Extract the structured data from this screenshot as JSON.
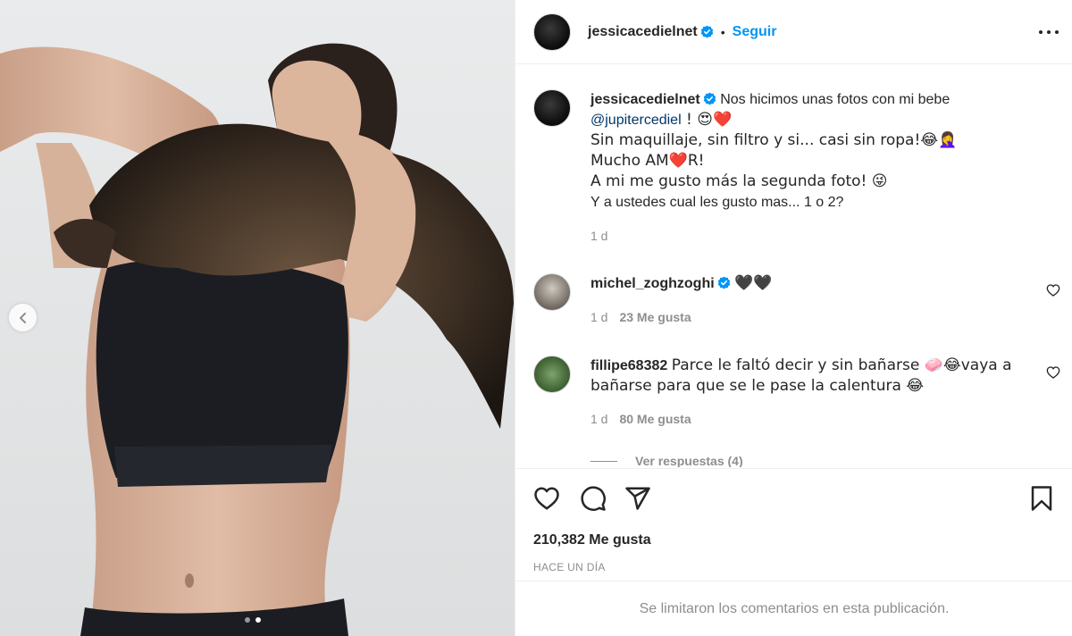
{
  "header": {
    "username": "jessicacedielnet",
    "separator": "•",
    "follow_label": "Seguir"
  },
  "caption": {
    "username": "jessicacedielnet",
    "line1": "Nos hicimos unas fotos con mi bebe",
    "mention": "@jupitercediel",
    "line2_tail": " ! 😍❤️",
    "line3": "Sin maquillaje, sin filtro y si... casi sin ropa!😂🤦‍♀️",
    "line4": "Mucho AM❤️R!",
    "line5": "A mi me gusto más la segunda foto! 😜",
    "line6": "Y a ustedes cual les gusto mas... 1 o 2?",
    "time": "1 d"
  },
  "comments": [
    {
      "username": "michel_zoghzoghi",
      "text": "🖤🖤",
      "time": "1 d",
      "likes": "23 Me gusta"
    },
    {
      "username": "fillipe68382",
      "text": "Parce le faltó decir y sin bañarse 🧼😂vaya a bañarse para que se le pase la calentura 😂",
      "time": "1 d",
      "likes": "80 Me gusta",
      "replies_label": "Ver respuestas (4)"
    }
  ],
  "footer": {
    "likes": "210,382 Me gusta",
    "when": "HACE UN DÍA",
    "limited_notice": "Se limitaron los comentarios en esta publicación."
  },
  "carousel": {
    "current": 2,
    "total": 2
  },
  "icons": [
    "chevron-left-icon",
    "verified-icon",
    "more-icon",
    "heart-icon",
    "comment-icon",
    "share-icon",
    "bookmark-icon"
  ],
  "colors": {
    "accent": "#0095f6",
    "text": "#262626",
    "muted": "#8e8e8e",
    "mention": "#00376b",
    "border": "#efefef"
  }
}
